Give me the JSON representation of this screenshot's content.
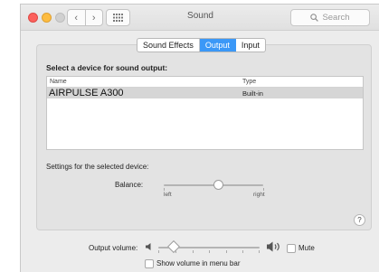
{
  "window": {
    "title": "Sound"
  },
  "toolbar": {
    "back": "‹",
    "forward": "›",
    "grid_icon": "grid-icon",
    "search_placeholder": "Search"
  },
  "tabs": [
    {
      "label": "Sound Effects",
      "active": false
    },
    {
      "label": "Output",
      "active": true
    },
    {
      "label": "Input",
      "active": false
    }
  ],
  "output": {
    "heading": "Select a device for sound output:",
    "columns": [
      "Name",
      "Type"
    ],
    "devices": [
      {
        "name": "AIRPULSE A300",
        "type": "Built-in",
        "selected": true
      }
    ],
    "settings_label": "Settings for the selected device:",
    "balance": {
      "label": "Balance:",
      "left": "left",
      "right": "right",
      "value": 0.55
    }
  },
  "help": "?",
  "volume": {
    "label": "Output volume:",
    "value": 0.15,
    "mute_label": "Mute",
    "mute_checked": false,
    "show_in_menubar_label": "Show volume in menu bar",
    "show_in_menubar_checked": false
  },
  "colors": {
    "accent": "#3b98f7",
    "close": "#fc605c",
    "minimize": "#fdbc40"
  }
}
